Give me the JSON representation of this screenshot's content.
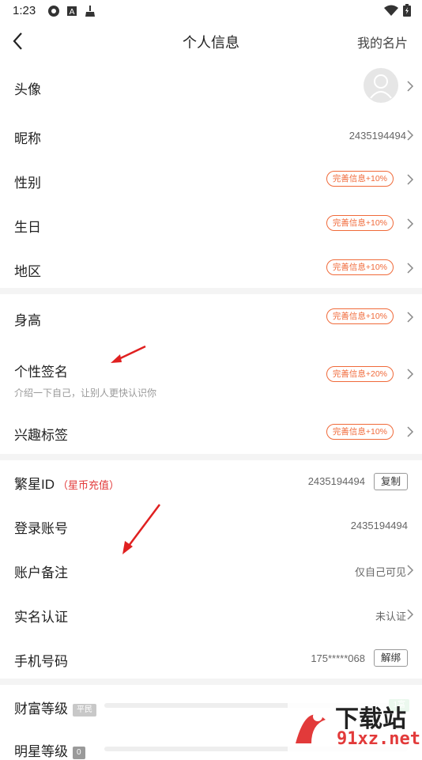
{
  "status": {
    "time": "1:23"
  },
  "nav": {
    "title": "个人信息",
    "right": "我的名片"
  },
  "rows": {
    "avatar": {
      "label": "头像"
    },
    "nickname": {
      "label": "昵称",
      "value": "2435194494"
    },
    "gender": {
      "label": "性别",
      "badge": "完善信息+10%"
    },
    "birthday": {
      "label": "生日",
      "badge": "完善信息+10%"
    },
    "region": {
      "label": "地区",
      "badge": "完善信息+10%"
    },
    "height": {
      "label": "身高",
      "badge": "完善信息+10%"
    },
    "signature": {
      "label": "个性签名",
      "badge": "完善信息+20%",
      "sub": "介绍一下自己，让别人更快认识你"
    },
    "interests": {
      "label": "兴趣标签",
      "badge": "完善信息+10%"
    },
    "fanxing_id": {
      "label": "繁星ID",
      "note": "（星币充值）",
      "value": "2435194494",
      "button": "复制"
    },
    "login_account": {
      "label": "登录账号",
      "value": "2435194494"
    },
    "account_note": {
      "label": "账户备注",
      "value": "仅自己可见"
    },
    "realname": {
      "label": "实名认证",
      "value": "未认证"
    },
    "phone": {
      "label": "手机号码",
      "value": "175*****068",
      "button": "解绑"
    },
    "wealth": {
      "label": "财富等级",
      "tag": "平民",
      "right_tag": "1富"
    },
    "star": {
      "label": "明星等级",
      "tag": "0"
    }
  },
  "watermark": {
    "text": "下载站",
    "domain": "91xz.net"
  },
  "colors": {
    "accent": "#f06a3a",
    "red": "#e23a3a",
    "divider": "#f4f4f4"
  }
}
